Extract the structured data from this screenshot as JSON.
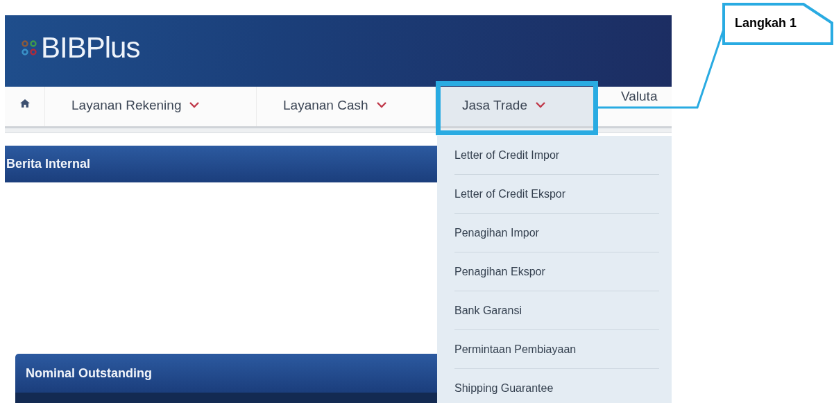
{
  "header": {
    "logo": "BIBPlus"
  },
  "nav": {
    "items": [
      {
        "label": "Layanan Rekening",
        "selected": false
      },
      {
        "label": "Layanan Cash",
        "selected": false
      },
      {
        "label": "Jasa Trade",
        "selected": true
      },
      {
        "label": "Valuta",
        "selected": false
      }
    ]
  },
  "dropdown": {
    "items": [
      "Letter of Credit Impor",
      "Letter of Credit Ekspor",
      "Penagihan Impor",
      "Penagihan Ekspor",
      "Bank Garansi",
      "Permintaan Pembiayaan",
      "Shipping Guarantee"
    ]
  },
  "panels": [
    {
      "title": "Berita Internal"
    },
    {
      "title": "Nominal Outstanding"
    }
  ],
  "callout": {
    "label": "Langkah 1"
  }
}
